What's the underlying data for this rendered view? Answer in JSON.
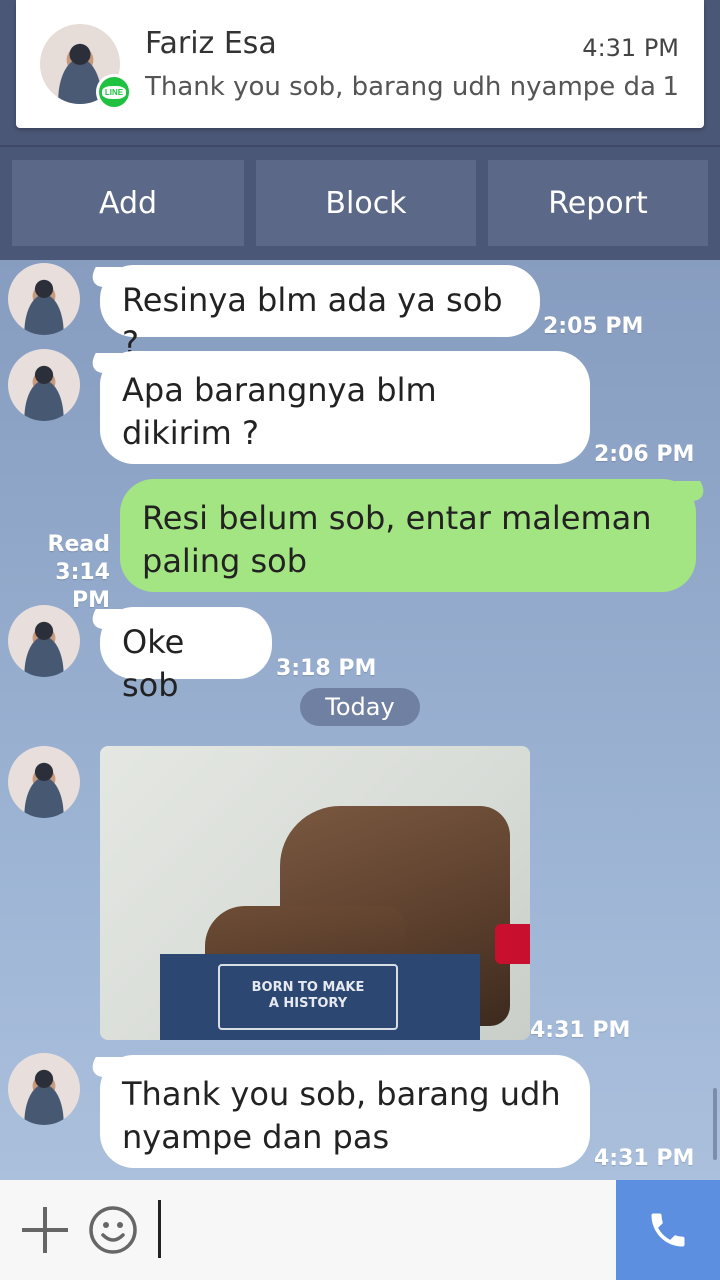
{
  "notification": {
    "sender": "Fariz Esa",
    "time": "4:31 PM",
    "message": "Thank you sob, barang udh nyampe da..",
    "count": "1",
    "app_badge": "LINE"
  },
  "actions": {
    "add": "Add",
    "block": "Block",
    "report": "Report"
  },
  "messages": [
    {
      "dir": "in",
      "text": "Resinya blm ada ya sob ?",
      "time": "2:05 PM"
    },
    {
      "dir": "in",
      "text": "Apa barangnya blm dikirim ?",
      "time": "2:06 PM"
    },
    {
      "dir": "out",
      "text": "Resi belum sob, entar maleman paling sob",
      "time": "3:14 PM",
      "status": "Read"
    },
    {
      "dir": "in",
      "text": "Oke sob",
      "time": "3:18 PM"
    },
    {
      "dir": "in",
      "type": "image",
      "image_text": "BORN TO MAKE A HISTORY",
      "time": "4:31 PM"
    },
    {
      "dir": "in",
      "text": "Thank you sob, barang udh nyampe dan pas",
      "time": "4:31 PM"
    }
  ],
  "date_separator": "Today",
  "input": {
    "value": ""
  },
  "icons": {
    "plus": "plus-icon",
    "emoji": "emoji-icon",
    "call": "phone-icon"
  },
  "colors": {
    "outgoing_bubble": "#a4e583",
    "incoming_bubble": "#ffffff",
    "call_button": "#5d8fe0",
    "header": "#4b5777"
  }
}
